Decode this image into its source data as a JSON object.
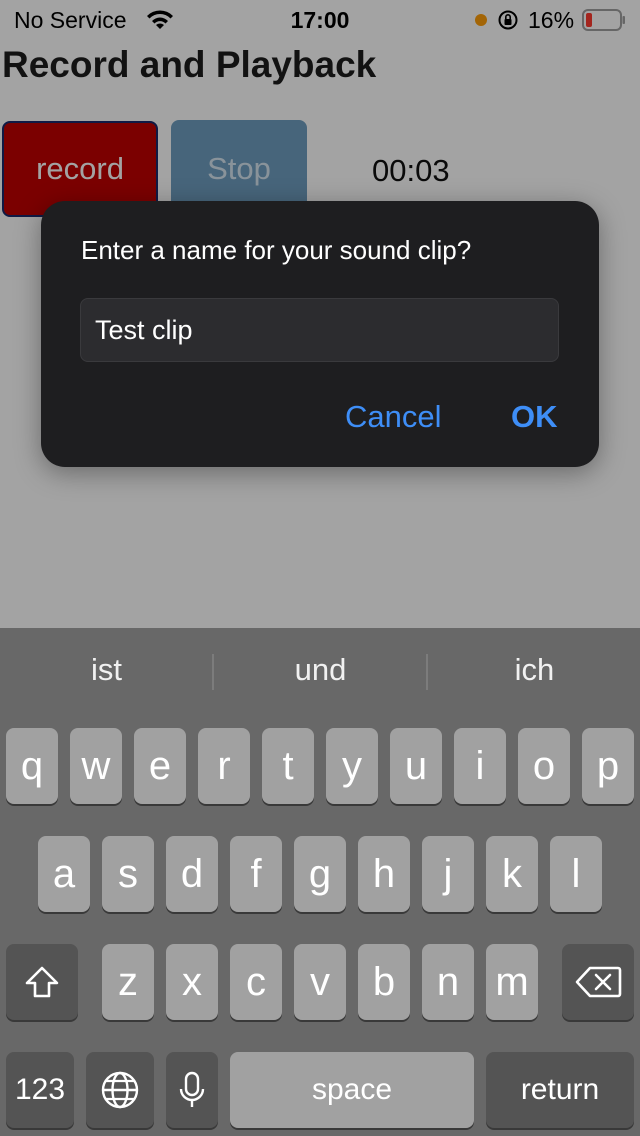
{
  "status_bar": {
    "carrier": "No Service",
    "time": "17:00",
    "battery_percent": "16%"
  },
  "app": {
    "title": "Record and Playback",
    "record_label": "record",
    "stop_label": "Stop",
    "timer": "00:03"
  },
  "dialog": {
    "message": "Enter a name for your sound clip?",
    "input_value": "Test clip",
    "cancel_label": "Cancel",
    "ok_label": "OK"
  },
  "keyboard": {
    "suggestions": [
      "ist",
      "und",
      "ich"
    ],
    "row1": [
      "q",
      "w",
      "e",
      "r",
      "t",
      "y",
      "u",
      "i",
      "o",
      "p"
    ],
    "row2": [
      "a",
      "s",
      "d",
      "f",
      "g",
      "h",
      "j",
      "k",
      "l"
    ],
    "row3": [
      "z",
      "x",
      "c",
      "v",
      "b",
      "n",
      "m"
    ],
    "numbers_label": "123",
    "space_label": "space",
    "return_label": "return"
  },
  "colors": {
    "record": "#c00000",
    "stop": "#6f9ec0",
    "accent": "#3e8ef7",
    "dialog_bg": "#1e1e20",
    "keyboard_bg": "#686868"
  },
  "icons": [
    "wifi-icon",
    "orientation-lock-icon",
    "battery-icon",
    "shift-icon",
    "backspace-icon",
    "globe-icon",
    "microphone-icon"
  ]
}
